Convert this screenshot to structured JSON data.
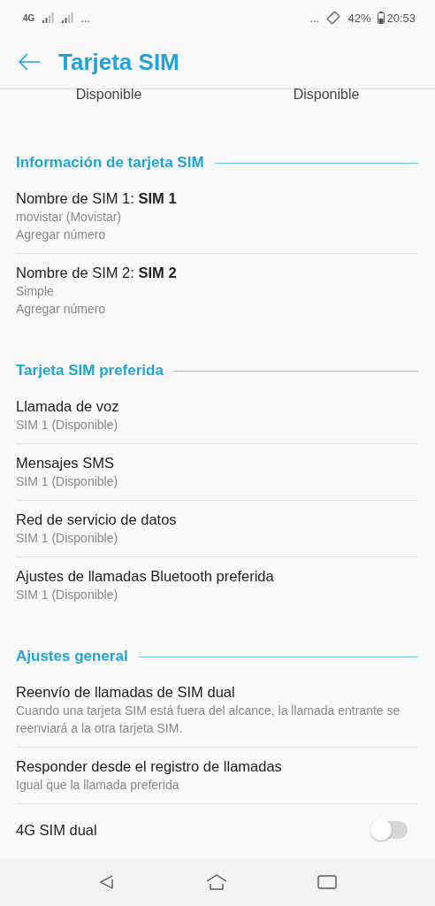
{
  "status_bar": {
    "network": "4G",
    "left_more": "...",
    "right_more": "...",
    "battery": "42%",
    "time": "20:53"
  },
  "header": {
    "title": "Tarjeta SIM"
  },
  "sim_status": [
    "Disponible",
    "Disponible"
  ],
  "sections": [
    {
      "title": "Información de tarjeta SIM",
      "items": [
        {
          "kind": "setting",
          "title": "Nombre de SIM 1: **SIM 1**",
          "lines": [
            "movistar (Movistar)",
            "Agregar número"
          ]
        },
        {
          "kind": "setting",
          "title": "Nombre de SIM 2: **SIM 2**",
          "lines": [
            "Simple",
            "Agregar número"
          ]
        }
      ]
    },
    {
      "title": "Tarjeta SIM preferida",
      "items": [
        {
          "kind": "setting",
          "title": "Llamada de voz",
          "lines": [
            "SIM 1 (Disponible)"
          ]
        },
        {
          "kind": "setting",
          "title": "Mensajes SMS",
          "lines": [
            "SIM 1 (Disponible)"
          ]
        },
        {
          "kind": "setting",
          "title": "Red de servicio de datos",
          "lines": [
            "SIM 1 (Disponible)"
          ]
        },
        {
          "kind": "setting",
          "title": "Ajustes de llamadas Bluetooth preferida",
          "lines": [
            "SIM 1 (Disponible)"
          ]
        }
      ]
    },
    {
      "title": "Ajustes general",
      "items": [
        {
          "kind": "setting",
          "title": "Reenvío de llamadas de SIM dual",
          "lines": [
            "Cuando una tarjeta SIM está fuera del alcance, la llamada entrante se reenviará a la otra tarjeta SIM."
          ]
        },
        {
          "kind": "setting",
          "title": "Responder desde el registro de llamadas",
          "lines": [
            "Igual que la llamada preferida"
          ]
        },
        {
          "kind": "toggle",
          "title": "4G SIM dual",
          "on": false
        }
      ]
    }
  ]
}
